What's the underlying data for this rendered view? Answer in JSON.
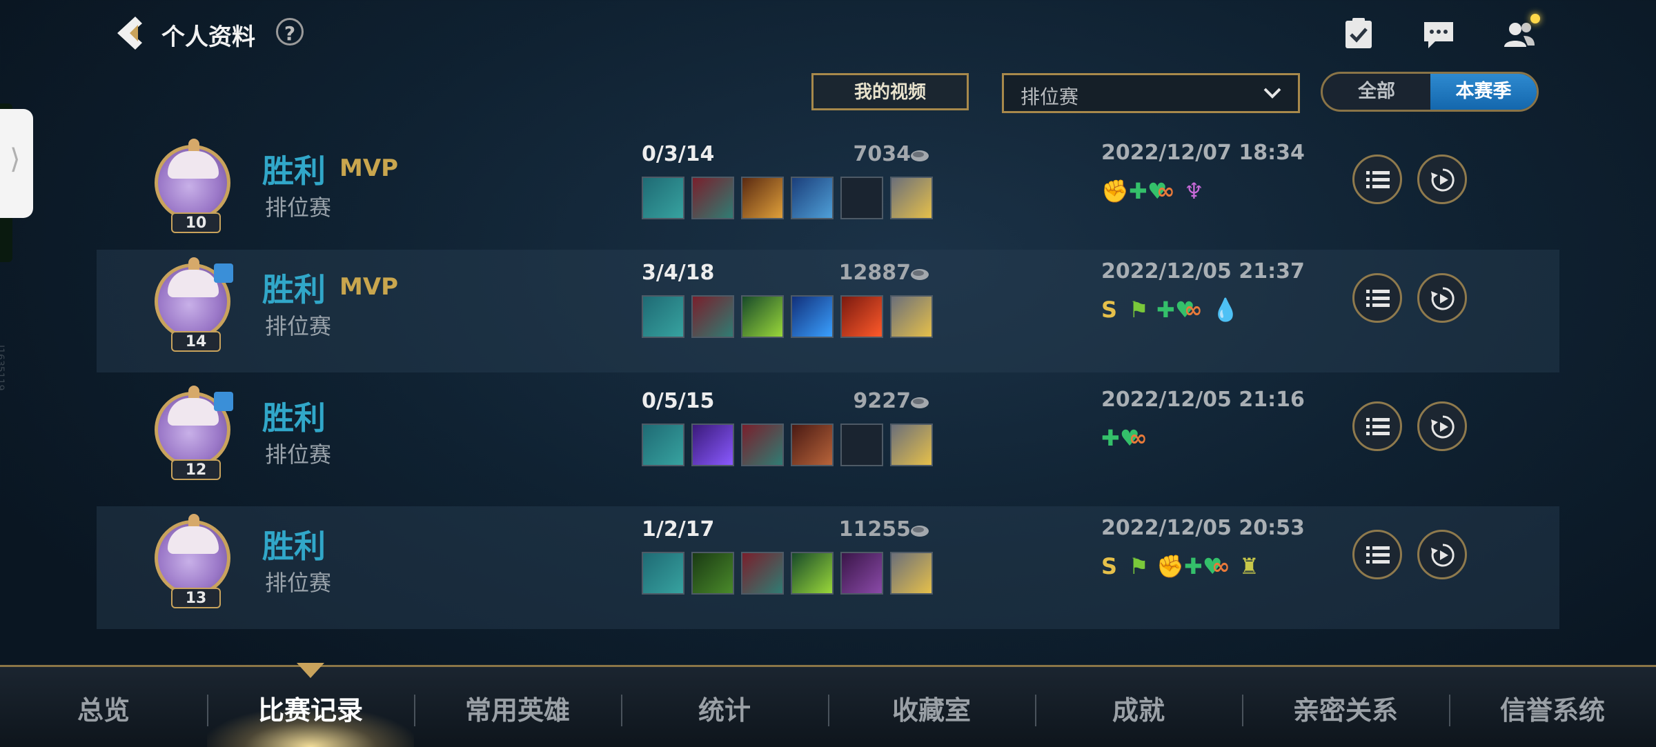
{
  "header": {
    "title": "个人资料",
    "help": "?"
  },
  "filters": {
    "my_videos_label": "我的视频",
    "mode_select_value": "排位赛",
    "season_toggle": [
      "全部",
      "本赛季"
    ],
    "season_selected": "本赛季"
  },
  "side_label": "I1635119",
  "matches": [
    {
      "level": "10",
      "result": "胜利",
      "mvp": "MVP",
      "mode": "排位赛",
      "kda": "0/3/14",
      "gold": "7034",
      "date": "2022/12/07 18:34",
      "items": [
        "scythe-item",
        "dark-armor-item",
        "gold-hammer-item",
        "blue-tome-item",
        "empty-slot",
        "feather-ward-item"
      ],
      "badges": [
        "fist-badge",
        "heal-badge",
        "chain-badge",
        "wings-badge"
      ]
    },
    {
      "level": "14",
      "result": "胜利",
      "mvp": "MVP",
      "mode": "排位赛",
      "kda": "3/4/18",
      "gold": "12887",
      "date": "2022/12/05 21:37",
      "items": [
        "scythe-item",
        "dark-armor-item",
        "green-orb-item",
        "blue-dragon-item",
        "fire-potion-item",
        "feather-ward-item"
      ],
      "badges": [
        "S",
        "flag-badge",
        "heal-badge",
        "chain-badge",
        "droplet-badge"
      ]
    },
    {
      "level": "12",
      "result": "胜利",
      "mvp": "",
      "mode": "排位赛",
      "kda": "0/5/15",
      "gold": "9227",
      "date": "2022/12/05 21:16",
      "items": [
        "scythe-item",
        "purple-crystal-item",
        "dark-armor-item",
        "red-tome-item",
        "empty-slot",
        "feather-ward-item"
      ],
      "badges": [
        "heal-badge",
        "chain-badge"
      ]
    },
    {
      "level": "13",
      "result": "胜利",
      "mvp": "",
      "mode": "排位赛",
      "kda": "1/2/17",
      "gold": "11255",
      "date": "2022/12/05 20:53",
      "items": [
        "scythe-item",
        "green-shield-item",
        "dark-armor-item",
        "green-orb-item",
        "purple-tome-item",
        "feather-ward-item"
      ],
      "badges": [
        "S",
        "flag-badge",
        "fist-badge",
        "heal-badge",
        "chain-badge",
        "tower-badge"
      ]
    }
  ],
  "bottom_tabs": [
    "总览",
    "比赛记录",
    "常用英雄",
    "统计",
    "收藏室",
    "成就",
    "亲密关系",
    "信誉系统"
  ],
  "active_tab": "比赛记录",
  "colors": {
    "accent_gold": "#a8894b",
    "win_blue": "#31a7c9",
    "mvp_gold": "#c9a64e",
    "selected_blue": "#1e79bf"
  }
}
